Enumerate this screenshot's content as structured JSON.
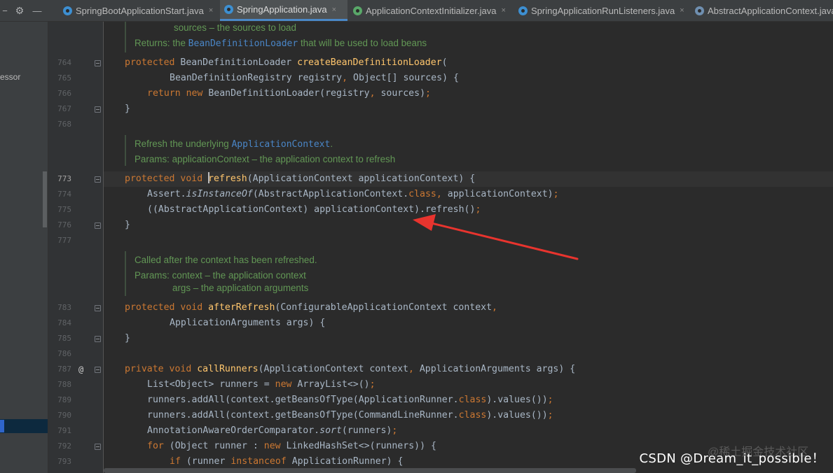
{
  "tabs": [
    {
      "label": "SpringBootApplicationStart.java",
      "icon": "class-icon",
      "active": false
    },
    {
      "label": "SpringApplication.java",
      "icon": "class-icon",
      "active": true
    },
    {
      "label": "ApplicationContextInitializer.java",
      "icon": "interface-icon",
      "active": false
    },
    {
      "label": "SpringApplicationRunListeners.java",
      "icon": "class-icon",
      "active": false
    },
    {
      "label": "AbstractApplicationContext.java",
      "icon": "abstract-class-icon",
      "active": false
    }
  ],
  "toolbar": {
    "collapse_glyph": "−",
    "settings_glyph": "⚙",
    "minimize_glyph": "—",
    "tab_close_glyph": "×"
  },
  "project_pane": {
    "partial_text": "essor"
  },
  "gutter": {
    "override_marker": "@"
  },
  "line_numbers": [
    "764",
    "765",
    "766",
    "767",
    "768",
    "773",
    "774",
    "775",
    "776",
    "777",
    "783",
    "784",
    "785",
    "786",
    "787",
    "788",
    "789",
    "790",
    "791",
    "792",
    "793"
  ],
  "docs": {
    "load": {
      "sources_line": "sources – the sources to load",
      "returns_prefix": "Returns: the ",
      "returns_link": "BeanDefinitionLoader",
      "returns_suffix": " that will be used to load beans"
    },
    "refresh": {
      "line1_prefix": "Refresh the underlying ",
      "line1_link": "ApplicationContext",
      "line1_suffix": ".",
      "params": "Params: applicationContext – the application context to refresh"
    },
    "after_refresh": {
      "line1": "Called after the context has been refreshed.",
      "params": "Params: context – the application context",
      "args": "args – the application arguments"
    }
  },
  "code": {
    "l764": {
      "kw": "protected",
      "type": " BeanDefinitionLoader ",
      "fn": "createBeanDefinitionLoader",
      "rest": "("
    },
    "l765": {
      "a": "BeanDefinitionRegistry registry",
      "comma": ",",
      "b": " Object[] sources) {"
    },
    "l766": {
      "kw1": "return",
      "kw2": " new",
      "rest": " BeanDefinitionLoader(registry",
      "comma": ",",
      "rest2": " sources)",
      "semi": ";"
    },
    "l767": {
      "text": "}"
    },
    "l773": {
      "kw": "protected void",
      "fn": "refresh",
      "rest": "(ApplicationContext applicationContext) {"
    },
    "l774": {
      "a": "Assert.",
      "it": "isInstanceOf",
      "b": "(AbstractApplicationContext.",
      "kw": "class",
      "comma": ",",
      "c": " applicationContext)",
      "semi": ";"
    },
    "l775": {
      "text": "((AbstractApplicationContext) applicationContext).refresh()",
      "semi": ";"
    },
    "l776": {
      "text": "}"
    },
    "l783": {
      "kw": "protected void",
      "fn": "afterRefresh",
      "rest": "(ConfigurableApplicationContext context",
      "comma": ","
    },
    "l784": {
      "text": "ApplicationArguments args) {"
    },
    "l785": {
      "text": "}"
    },
    "l787": {
      "kw": "private void",
      "fn": "callRunners",
      "a": "(ApplicationContext context",
      "comma": ",",
      "b": " ApplicationArguments args) {"
    },
    "l788": {
      "a": "List<Object> runners = ",
      "kw": "new",
      "b": " ArrayList<>()",
      "semi": ";"
    },
    "l789": {
      "a": "runners.addAll(context.getBeansOfType(ApplicationRunner.",
      "kw": "class",
      "b": ").values())",
      "semi": ";"
    },
    "l790": {
      "a": "runners.addAll(context.getBeansOfType(CommandLineRunner.",
      "kw": "class",
      "b": ").values())",
      "semi": ";"
    },
    "l791": {
      "a": "AnnotationAwareOrderComparator.",
      "it": "sort",
      "b": "(runners)",
      "semi": ";"
    },
    "l792": {
      "kw1": "for",
      "a": " (Object runner : ",
      "kw2": "new",
      "b": " LinkedHashSet<>(runners)) {"
    },
    "l793": {
      "kw1": "if",
      "a": " (runner ",
      "kw2": "instanceof",
      "b": " ApplicationRunner) {"
    }
  },
  "colors": {
    "keyword": "#cc7832",
    "method": "#ffc66d",
    "doc": "#629755",
    "link": "#4a86c7",
    "arrow": "#e8342e"
  },
  "watermark": {
    "text": "CSDN @Dream_it_possible！",
    "back": "@稀土掘金技术社区"
  }
}
